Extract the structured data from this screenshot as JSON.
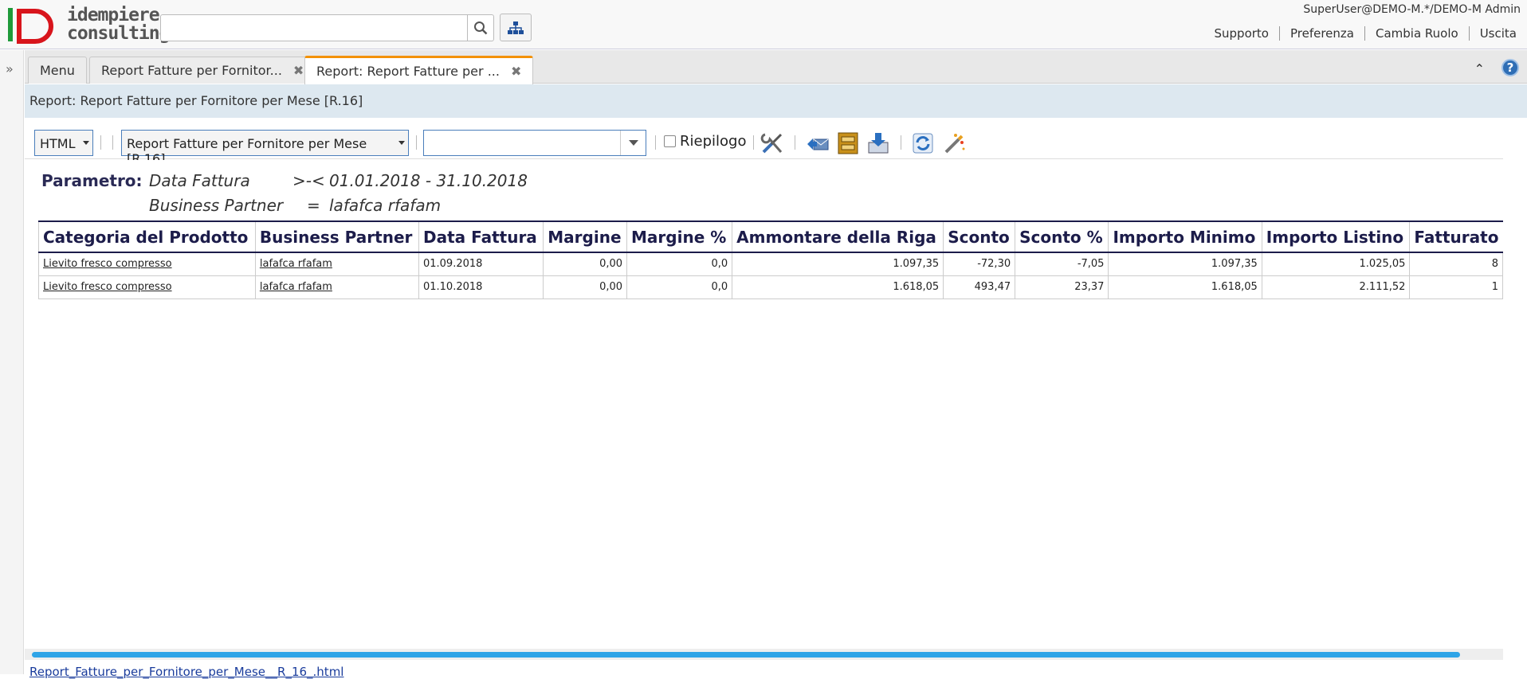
{
  "header": {
    "logo_line1": "idempiere",
    "logo_line2": "consulting",
    "search_placeholder": "",
    "user": "SuperUser@DEMO-M.*/DEMO-M Admin",
    "links": [
      "Supporto",
      "Preferenza",
      "Cambia Ruolo",
      "Uscita"
    ]
  },
  "tabs": [
    {
      "label": "Menu",
      "closable": false
    },
    {
      "label": "Report Fatture per Fornitor...",
      "closable": true
    },
    {
      "label": "Report: Report Fatture per ...",
      "closable": true,
      "active": true
    }
  ],
  "title": "Report: Report Fatture per Fornitore per Mese [R.16]",
  "toolbar": {
    "format_value": "HTML",
    "report_value": "Report Fatture per Fornitore per Mese [R.16]",
    "combo_value": "",
    "summary_label": "Riepilogo",
    "summary_checked": false
  },
  "report": {
    "param_label": "Parametro:",
    "params": [
      {
        "name": "Data Fattura",
        "op": ">-<",
        "value": "01.01.2018 - 31.10.2018"
      },
      {
        "name": "Business Partner",
        "op": "=",
        "value": "lafafca rfafam"
      }
    ],
    "columns": [
      "Categoria del Prodotto",
      "Business Partner",
      "Data Fattura",
      "Margine",
      "Margine %",
      "Ammontare della Riga",
      "Sconto",
      "Sconto %",
      "Importo Minimo",
      "Importo Listino",
      "Fatturato"
    ],
    "rows": [
      [
        "Lievito fresco compresso",
        "lafafca rfafam",
        "01.09.2018",
        "0,00",
        "0,0",
        "1.097,35",
        "-72,30",
        "-7,05",
        "1.097,35",
        "1.025,05",
        "8"
      ],
      [
        "Lievito fresco compresso",
        "lafafca rfafam",
        "01.10.2018",
        "0,00",
        "0,0",
        "1.618,05",
        "493,47",
        "23,37",
        "1.618,05",
        "2.111,52",
        "1"
      ]
    ]
  },
  "footer_link": "Report_Fatture_per_Fornitore_per_Mese__R_16_.html"
}
